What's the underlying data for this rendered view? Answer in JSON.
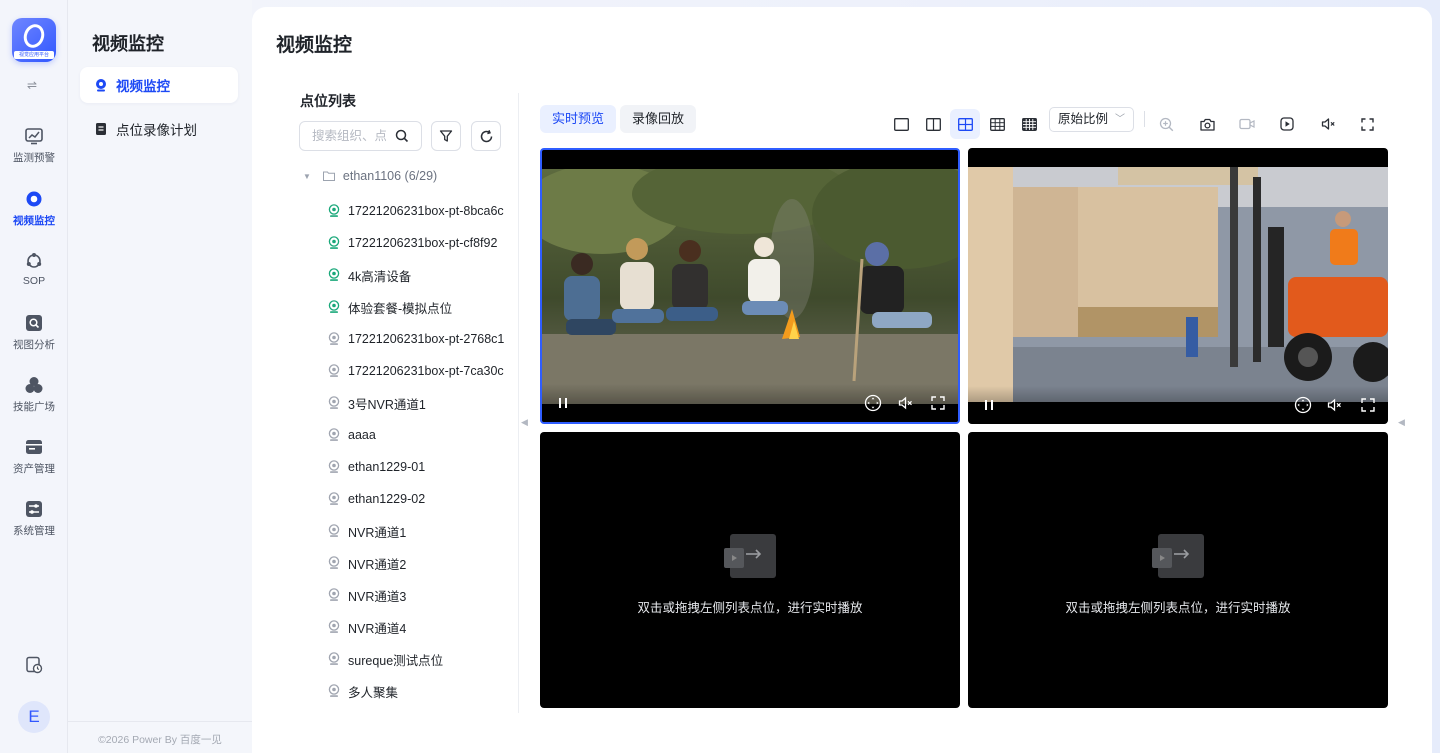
{
  "rail": {
    "logo_caption": "视觉应用平台",
    "items": [
      {
        "label": "监测预警",
        "icon": "monitor-chart-icon"
      },
      {
        "label": "视频监控",
        "icon": "video-monitor-icon",
        "active": true
      },
      {
        "label": "SOP",
        "icon": "sop-icon"
      },
      {
        "label": "视图分析",
        "icon": "view-analysis-icon"
      },
      {
        "label": "技能广场",
        "icon": "skills-icon"
      },
      {
        "label": "资产管理",
        "icon": "asset-icon"
      },
      {
        "label": "系统管理",
        "icon": "system-icon"
      }
    ],
    "avatar_letter": "E"
  },
  "subnav": {
    "title": "视频监控",
    "items": [
      {
        "label": "视频监控",
        "icon": "camera-icon",
        "active": true
      },
      {
        "label": "点位录像计划",
        "icon": "record-plan-icon"
      }
    ],
    "footer": "©2026 Power By 百度一见"
  },
  "main": {
    "page_title": "视频监控",
    "point_list": {
      "title": "点位列表",
      "search_placeholder": "搜索组织、点位",
      "root": "ethan1106 (6/29)",
      "items": [
        {
          "label": "17221206231box-pt-8bca6c",
          "online": true
        },
        {
          "label": "17221206231box-pt-cf8f92",
          "online": true
        },
        {
          "label": "4k高清设备",
          "online": true
        },
        {
          "label": "体验套餐-模拟点位",
          "online": true
        },
        {
          "label": "17221206231box-pt-2768c1",
          "online": false
        },
        {
          "label": "17221206231box-pt-7ca30c",
          "online": false
        },
        {
          "label": "3号NVR通道1",
          "online": false
        },
        {
          "label": "aaaa",
          "online": false
        },
        {
          "label": "ethan1229-01",
          "online": false
        },
        {
          "label": "ethan1229-02",
          "online": false
        },
        {
          "label": "NVR通道1",
          "online": false
        },
        {
          "label": "NVR通道2",
          "online": false
        },
        {
          "label": "NVR通道3",
          "online": false
        },
        {
          "label": "NVR通道4",
          "online": false
        },
        {
          "label": "sureque测试点位",
          "online": false
        },
        {
          "label": "多人聚集",
          "online": false
        }
      ]
    },
    "toolbar": {
      "tabs": [
        {
          "label": "实时预览",
          "active": true
        },
        {
          "label": "录像回放",
          "active": false
        }
      ],
      "layout_icons": [
        "layout-1-icon",
        "layout-2-icon",
        "layout-4-icon",
        "layout-9-icon",
        "layout-16-icon"
      ],
      "active_layout": "layout-4-icon",
      "ratio": "原始比例",
      "action_icons": [
        "zoom-in-icon",
        "snapshot-icon",
        "record-icon",
        "playback-icon",
        "mute-icon",
        "fullscreen-icon"
      ]
    },
    "tiles": [
      {
        "state": "playing",
        "scene": "campfire"
      },
      {
        "state": "playing",
        "scene": "warehouse"
      },
      {
        "state": "empty",
        "hint": "双击或拖拽左侧列表点位，进行实时播放"
      },
      {
        "state": "empty",
        "hint": "双击或拖拽左侧列表点位，进行实时播放"
      }
    ]
  },
  "colors": {
    "accent": "#1d49f5",
    "online": "#1aa87a",
    "offline": "#a0a5b0"
  }
}
